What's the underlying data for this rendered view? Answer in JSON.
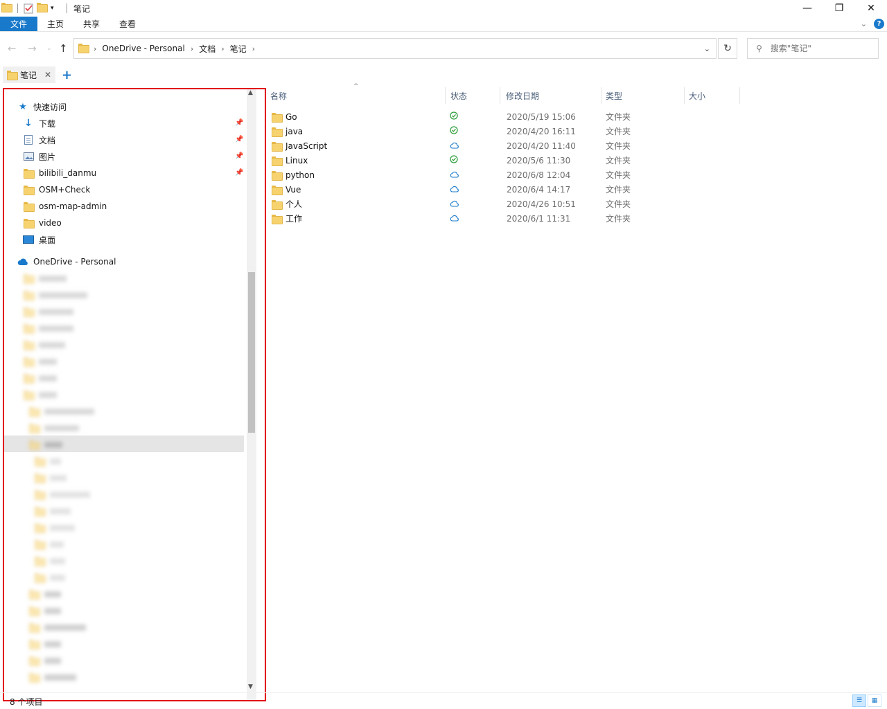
{
  "window": {
    "title": "笔记",
    "controls": {
      "minimize": "—",
      "maximize": "❐",
      "close": "✕"
    }
  },
  "ribbon": {
    "tabs": [
      "文件",
      "主页",
      "共享",
      "查看"
    ]
  },
  "address": {
    "crumbs": [
      "OneDrive - Personal",
      "文档",
      "笔记"
    ],
    "search_placeholder": "搜索\"笔记\""
  },
  "tabs": {
    "open": [
      {
        "label": "笔记"
      }
    ],
    "add": "+"
  },
  "nav": {
    "quick_access": {
      "label": "快速访问",
      "items": [
        {
          "label": "下载",
          "icon": "download-icon",
          "pinned": true
        },
        {
          "label": "文档",
          "icon": "document-icon",
          "pinned": true
        },
        {
          "label": "图片",
          "icon": "picture-icon",
          "pinned": true
        },
        {
          "label": "bilibili_danmu",
          "icon": "folder-icon",
          "pinned": true
        },
        {
          "label": "OSM+Check",
          "icon": "folder-icon",
          "pinned": false
        },
        {
          "label": "osm-map-admin",
          "icon": "folder-icon",
          "pinned": false
        },
        {
          "label": "video",
          "icon": "folder-icon",
          "pinned": false
        },
        {
          "label": "桌面",
          "icon": "desktop-icon",
          "pinned": false
        }
      ]
    },
    "onedrive": {
      "label": "OneDrive - Personal"
    }
  },
  "columns": {
    "name": "名称",
    "status": "状态",
    "date": "修改日期",
    "type": "类型",
    "size": "大小"
  },
  "files": [
    {
      "name": "Go",
      "status": "synced",
      "date": "2020/5/19 15:06",
      "type": "文件夹"
    },
    {
      "name": "java",
      "status": "synced",
      "date": "2020/4/20 16:11",
      "type": "文件夹"
    },
    {
      "name": "JavaScript",
      "status": "cloud",
      "date": "2020/4/20 11:40",
      "type": "文件夹"
    },
    {
      "name": "Linux",
      "status": "synced",
      "date": "2020/5/6 11:30",
      "type": "文件夹"
    },
    {
      "name": "python",
      "status": "cloud",
      "date": "2020/6/8 12:04",
      "type": "文件夹"
    },
    {
      "name": "Vue",
      "status": "cloud",
      "date": "2020/6/4 14:17",
      "type": "文件夹"
    },
    {
      "name": "个人",
      "status": "cloud",
      "date": "2020/4/26 10:51",
      "type": "文件夹"
    },
    {
      "name": "工作",
      "status": "cloud",
      "date": "2020/6/1 11:31",
      "type": "文件夹"
    }
  ],
  "status_bar": {
    "count": "8 个项目"
  },
  "colors": {
    "accent": "#1979ca",
    "highlight_border": "#e1000f",
    "synced": "#2e9e3e",
    "cloud": "#1979ca"
  }
}
